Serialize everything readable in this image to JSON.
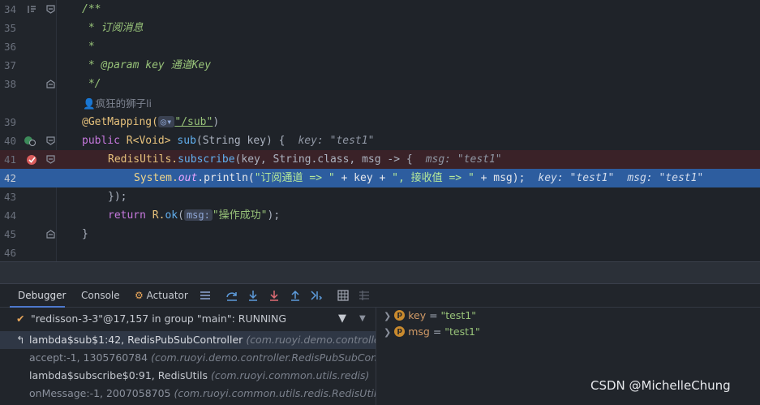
{
  "editor": {
    "lines": [
      {
        "num": "34",
        "text": "/**"
      },
      {
        "num": "35",
        "text": " * 订阅消息"
      },
      {
        "num": "36",
        "text": " *"
      },
      {
        "num": "37",
        "text": " * @param key 通道Key"
      },
      {
        "num": "38",
        "text": " */"
      },
      {
        "num": "39",
        "annotation": "@GetMapping(",
        "path": "\"/sub\"",
        "close": ")"
      },
      {
        "num": "40",
        "kw": "public",
        "type": "R<Void>",
        "fn": "sub",
        "params": "(String key) {",
        "hint": "key: \"test1\""
      },
      {
        "num": "41",
        "pre": "RedisUtils.",
        "fn": "subscribe",
        "args": "(key, String.class, msg -> {",
        "hint": "msg: \"test1\""
      },
      {
        "num": "42",
        "pre": "System.",
        "out": "out",
        "mid": ".println(",
        "str1": "\"订阅通道 => \"",
        "plus1": " + key + ",
        "str2": "\", 接收值 => \"",
        "plus2": " + msg);",
        "hint1": "key: \"test1\"",
        "hint2": "msg: \"test1\""
      },
      {
        "num": "43",
        "text": "});"
      },
      {
        "num": "44",
        "kw": "return",
        "pre": " R.",
        "fn": "ok",
        "inlay": "msg:",
        "str": "\"操作成功\"",
        "close": ");"
      },
      {
        "num": "45",
        "text": "}"
      },
      {
        "num": "46",
        "text": ""
      }
    ],
    "author": "疯狂的狮子li"
  },
  "debug_panel": {
    "tabs": {
      "debugger": "Debugger",
      "console": "Console",
      "actuator": "Actuator"
    },
    "thread": "\"redisson-3-3\"@17,157 in group \"main\": RUNNING",
    "frames": [
      {
        "name": "lambda$sub$1:42, RedisPubSubController",
        "loc": "(com.ruoyi.demo.controller"
      },
      {
        "name": "accept:-1, 1305760784",
        "loc": "(com.ruoyi.demo.controller.RedisPubSubCont"
      },
      {
        "name": "lambda$subscribe$0:91, RedisUtils",
        "loc": "(com.ruoyi.common.utils.redis)"
      },
      {
        "name": "onMessage:-1, 2007058705",
        "loc": "(com.ruoyi.common.utils.redis.RedisUtils$"
      }
    ],
    "variables": [
      {
        "name": "key",
        "value": "\"test1\""
      },
      {
        "name": "msg",
        "value": "\"test1\""
      }
    ]
  },
  "watermark": "CSDN @MichelleChung",
  "colors": {
    "selected_line": "#2d5d9f",
    "breakpoint_line": "#3a2228",
    "accent": "#4d78cc"
  }
}
